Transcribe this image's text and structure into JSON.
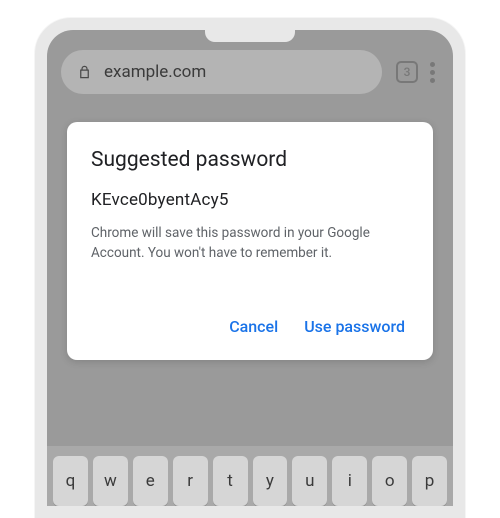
{
  "urlbar": {
    "domain": "example.com",
    "tab_count": "3"
  },
  "modal": {
    "title": "Suggested password",
    "password": "KEvce0byentAcy5",
    "description": "Chrome will save this password in your Google Account. You won't have to remember it.",
    "cancel_label": "Cancel",
    "use_label": "Use password"
  },
  "keyboard": {
    "row1": [
      "q",
      "w",
      "e",
      "r",
      "t",
      "y",
      "u",
      "i",
      "o",
      "p"
    ]
  },
  "colors": {
    "primary": "#1a73e8",
    "text": "#202124",
    "muted": "#5f6368"
  }
}
